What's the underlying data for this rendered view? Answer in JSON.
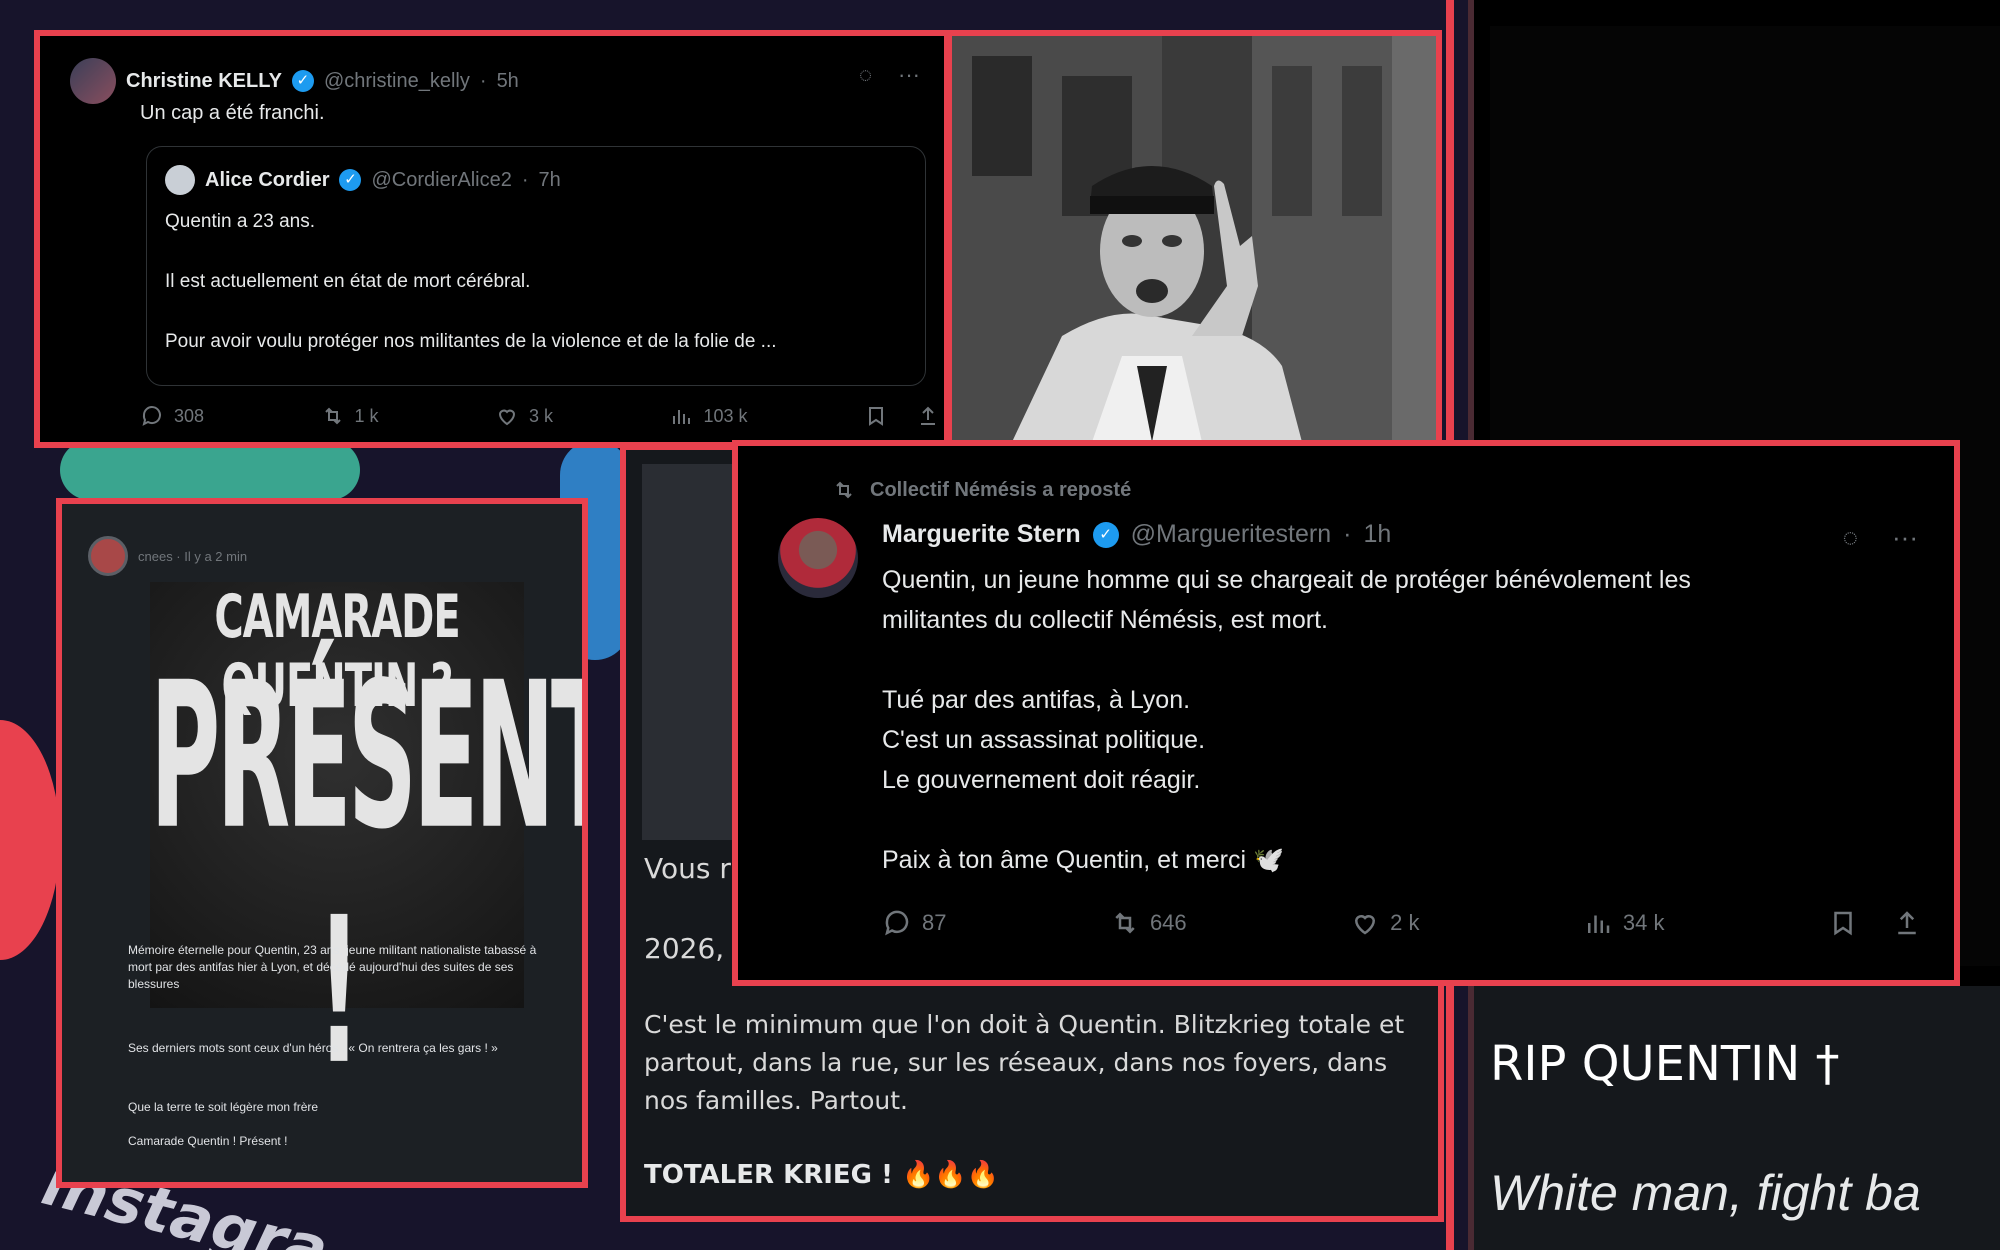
{
  "background": {
    "instagram_word": "instagra"
  },
  "tweet_kelly": {
    "author_name": "Christine KELLY",
    "handle": "@christine_kelly",
    "time": "5h",
    "text": "Un cap a été franchi.",
    "quoted": {
      "author_name": "Alice Cordier",
      "handle": "@CordierAlice2",
      "time": "7h",
      "line1": "Quentin a 23 ans.",
      "line2": "Il est actuellement en état de mort cérébral.",
      "line3": "Pour avoir voulu protéger nos militantes de la violence et de la folie de ..."
    },
    "stats": {
      "replies": "308",
      "reposts": "1 k",
      "likes": "3 k",
      "views": "103 k"
    }
  },
  "tweet_stern": {
    "reposted_by": "Collectif Némésis a reposté",
    "author_name": "Marguerite Stern",
    "handle": "@Margueritestern",
    "time": "1h",
    "lines": [
      "Quentin, un jeune homme qui se chargeait de protéger bénévolement les",
      "militantes du collectif Némésis, est mort.",
      "",
      "Tué par des antifas, à Lyon.",
      "C'est un assassinat politique.",
      "Le gouvernement doit réagir.",
      "",
      "Paix à ton âme Quentin, et merci 🕊️"
    ],
    "stats": {
      "replies": "87",
      "reposts": "646",
      "likes": "2 k",
      "views": "34 k"
    }
  },
  "poster": {
    "header": "cnees · Il y a 2 min",
    "line1": "CAMARADE QUENTIN ?",
    "line2": "PRÉSENT !",
    "caption1": "Mémoire éternelle pour Quentin, 23 ans, jeune militant nationaliste tabassé à mort par des antifas hier à Lyon, et décédé aujourd'hui des suites de ses blessures",
    "caption2": "Ses derniers mots sont ceux d'un héros : « On rentrera ça les gars ! »",
    "caption3": "Que la terre te soit légère mon frère",
    "caption4": "Camarade Quentin ! Présent !"
  },
  "post_krieg": {
    "partial1": "Vous r",
    "partial2": "2026,",
    "body": "C'est le minimum que l'on doit à Quentin. Blitzkrieg totale et partout, dans la rue, sur les réseaux, dans nos foyers, dans nos familles. Partout.",
    "closing": "TOTALER KRIEG ! 🔥🔥🔥"
  },
  "post_rip": {
    "title": "RIP QUENTIN †",
    "slogan": "White man, fight ba"
  },
  "colors": {
    "frame": "#e8414e",
    "verified": "#1d9bf0",
    "background": "#17142b"
  }
}
